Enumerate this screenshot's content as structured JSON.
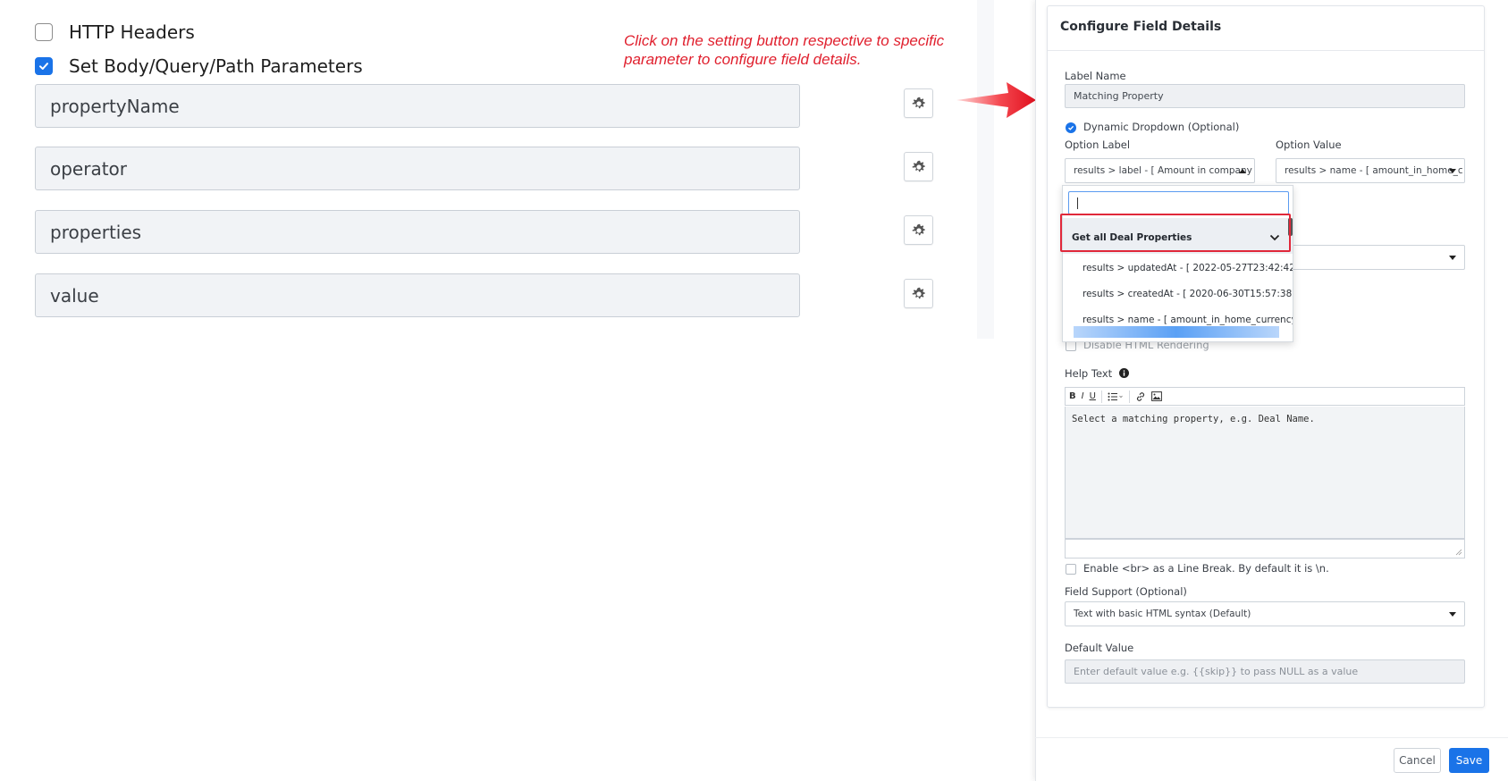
{
  "left": {
    "headers_checkbox": {
      "label": "HTTP Headers",
      "checked": false
    },
    "params_checkbox": {
      "label": "Set Body/Query/Path Parameters",
      "checked": true
    },
    "params": [
      {
        "name": "propertyName"
      },
      {
        "name": "operator"
      },
      {
        "name": "properties"
      },
      {
        "name": "value"
      }
    ],
    "gear_icon": "gear-icon"
  },
  "annotation": {
    "text": "Click on the setting button respective to specific parameter to configure field details.",
    "color": "#e0202e"
  },
  "modal": {
    "title": "Configure Field Details",
    "label_name": {
      "label": "Label Name",
      "value": "Matching Property"
    },
    "dynamic_dropdown": {
      "label": "Dynamic Dropdown (Optional)",
      "checked": true
    },
    "option_label": {
      "label": "Option Label",
      "value": "results > label - [ Amount in company"
    },
    "option_value": {
      "label": "Option Value",
      "value": "results > name - [ amount_in_home_c"
    },
    "dropdown_popup": {
      "search_value": "",
      "group": "Get all Deal Properties",
      "items": [
        "results > updatedAt - [ 2022-05-27T23:42:42.",
        "results > createdAt - [ 2020-06-30T15:57:38.4",
        "results > name - [ amount_in_home_currency"
      ]
    },
    "disable_html": {
      "label": "Disable HTML Rendering"
    },
    "help_text": {
      "label": "Help Text",
      "toolbar": [
        "B",
        "I",
        "U",
        "list",
        "link",
        "image"
      ],
      "value": "Select a matching property, e.g. Deal Name."
    },
    "line_break": {
      "label": "Enable <br> as a Line Break. By default it is \\n.",
      "checked": false
    },
    "field_support": {
      "label": "Field Support (Optional)",
      "value": "Text with basic HTML syntax (Default)"
    },
    "default_value": {
      "label": "Default Value",
      "placeholder": "Enter default value e.g. {{skip}} to pass NULL as a value"
    },
    "cancel": "Cancel",
    "save": "Save"
  },
  "colors": {
    "accent": "#1a73e8",
    "annotation": "#e0202e",
    "field_bg": "#f1f3f6"
  }
}
